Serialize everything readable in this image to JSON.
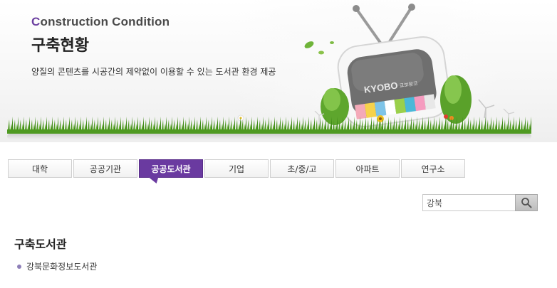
{
  "banner": {
    "title_en_first": "C",
    "title_en_rest": "onstruction Condition",
    "title_ko": "구축현황",
    "subtitle": "양질의 콘텐츠를 시공간의 제약없이 이용할 수 있는 도서관 환경 제공",
    "tv_logo": "KYOBO",
    "tv_logo_ko": "교보문고"
  },
  "tabs": [
    {
      "label": "대학",
      "active": false
    },
    {
      "label": "공공기관",
      "active": false
    },
    {
      "label": "공공도서관",
      "active": true
    },
    {
      "label": "기업",
      "active": false
    },
    {
      "label": "초/중/고",
      "active": false
    },
    {
      "label": "아파트",
      "active": false
    },
    {
      "label": "연구소",
      "active": false
    }
  ],
  "search": {
    "value": "강북",
    "icon": "search-icon"
  },
  "content": {
    "section_title": "구축도서관",
    "libraries": [
      "강북문화정보도서관"
    ]
  },
  "colors": {
    "accent": "#6a3aa0",
    "grass": "#5aa12a"
  }
}
